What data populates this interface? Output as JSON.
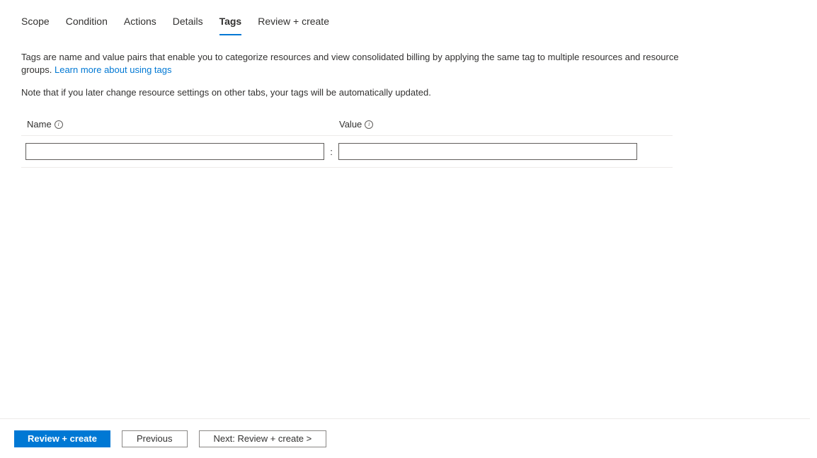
{
  "tabs": [
    {
      "label": "Scope",
      "active": false
    },
    {
      "label": "Condition",
      "active": false
    },
    {
      "label": "Actions",
      "active": false
    },
    {
      "label": "Details",
      "active": false
    },
    {
      "label": "Tags",
      "active": true
    },
    {
      "label": "Review + create",
      "active": false
    }
  ],
  "description": {
    "text_before": "Tags are name and value pairs that enable you to categorize resources and view consolidated billing by applying the same tag to multiple resources and resource groups. ",
    "link_text": "Learn more about using tags"
  },
  "note": "Note that if you later change resource settings on other tabs, your tags will be automatically updated.",
  "table": {
    "name_header": "Name",
    "value_header": "Value",
    "separator": ":",
    "row": {
      "name_value": "",
      "value_value": ""
    }
  },
  "footer": {
    "primary_label": "Review + create",
    "previous_label": "Previous",
    "next_label": "Next: Review + create >"
  }
}
